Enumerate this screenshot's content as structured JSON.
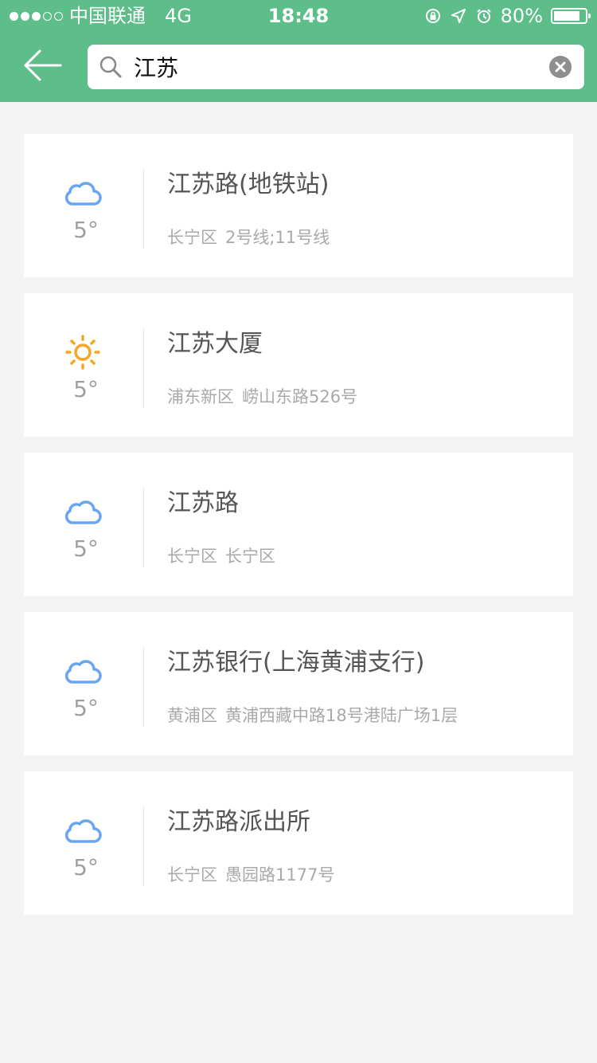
{
  "status_bar": {
    "carrier": "中国联通",
    "network": "4G",
    "time": "18:48",
    "battery": "80%",
    "signal_dots_filled": 3,
    "signal_dots_total": 5
  },
  "search": {
    "value": "江苏",
    "placeholder": ""
  },
  "colors": {
    "header": "#5ebe8a",
    "cloud": "#6aa6f0",
    "sun": "#f5a623"
  },
  "results": [
    {
      "weather": "cloud-icon",
      "temp": "5°",
      "title": "江苏路(地铁站)",
      "district": "长宁区",
      "address": "2号线;11号线"
    },
    {
      "weather": "sun-icon",
      "temp": "5°",
      "title": "江苏大厦",
      "district": "浦东新区",
      "address": "崂山东路526号"
    },
    {
      "weather": "cloud-icon",
      "temp": "5°",
      "title": "江苏路",
      "district": "长宁区",
      "address": "长宁区"
    },
    {
      "weather": "cloud-icon",
      "temp": "5°",
      "title": "江苏银行(上海黄浦支行)",
      "district": "黄浦区",
      "address": "黄浦西藏中路18号港陆广场1层"
    },
    {
      "weather": "cloud-icon",
      "temp": "5°",
      "title": "江苏路派出所",
      "district": "长宁区",
      "address": "愚园路1177号"
    }
  ]
}
